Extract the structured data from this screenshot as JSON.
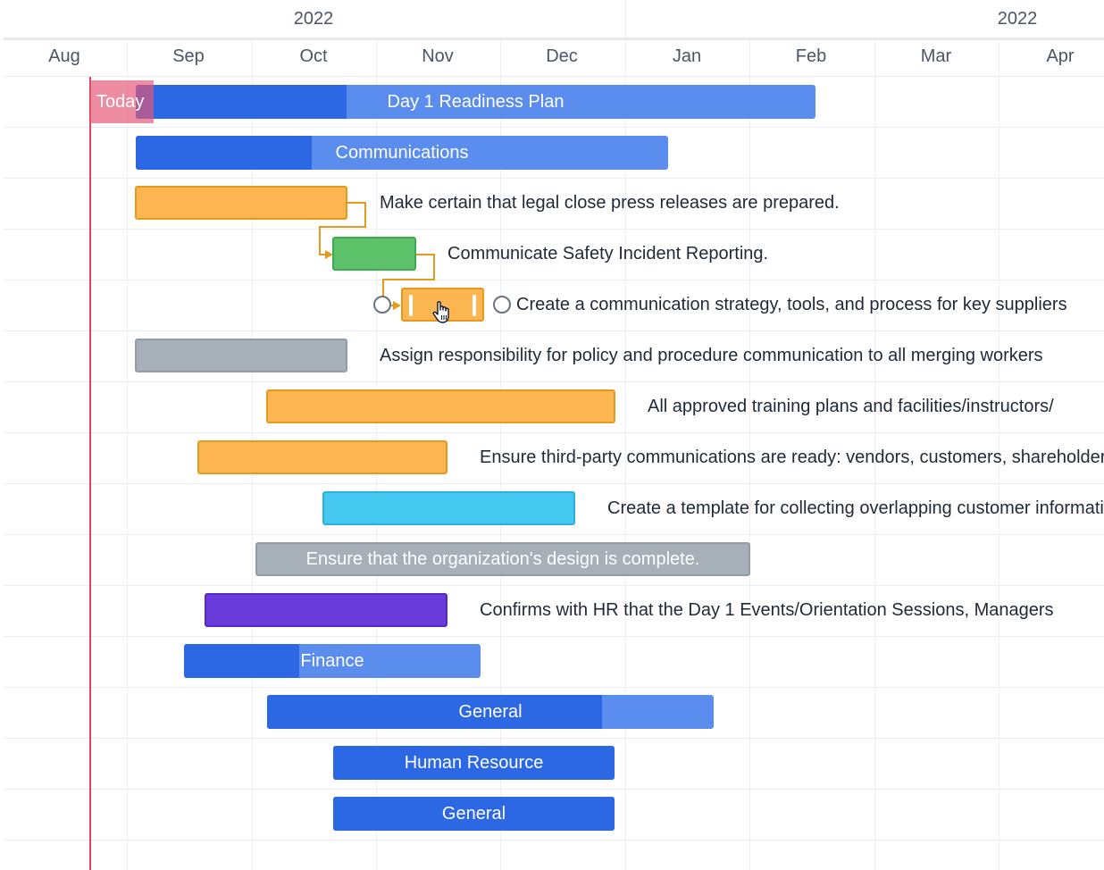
{
  "timeline": {
    "years": [
      "2022",
      "2022"
    ],
    "months": [
      "Aug",
      "Sep",
      "Oct",
      "Nov",
      "Dec",
      "Jan",
      "Feb",
      "Mar",
      "Apr"
    ],
    "today_label": "Today"
  },
  "tasks": [
    {
      "name": "Day 1 Readiness Plan",
      "label_position": "inside",
      "color": "#5b8def",
      "progress_color": "#2c68e3",
      "progress": 0.31
    },
    {
      "name": "Communications",
      "label_position": "inside",
      "color": "#5b8def",
      "progress_color": "#2c68e3",
      "progress": 0.33
    },
    {
      "name": "Make certain that legal close press releases are prepared.",
      "label_position": "outside",
      "color": "#fbb651",
      "border": "#e39a1f"
    },
    {
      "name": "Communicate Safety Incident Reporting.",
      "label_position": "outside",
      "color": "#5ec26a",
      "border": "#3fa94f"
    },
    {
      "name": "Create a communication strategy, tools, and process for key suppliers",
      "label_position": "outside",
      "color": "#fbb651",
      "border": "#e39a1f",
      "selected": true
    },
    {
      "name": "Assign responsibility for policy and procedure communication to all merging workers",
      "label_position": "outside",
      "color": "#a7b0b9",
      "border": "#939ca5"
    },
    {
      "name": "All approved training plans and facilities/instructors/",
      "label_position": "outside",
      "color": "#fbb651",
      "border": "#e39a1f"
    },
    {
      "name": "Ensure third-party communications are ready: vendors, customers, shareholders",
      "label_position": "outside",
      "color": "#fbb651",
      "border": "#e39a1f"
    },
    {
      "name": "Create a template for collecting overlapping customer information",
      "label_position": "outside",
      "color": "#45c8f0",
      "border": "#2bb1db"
    },
    {
      "name": "Ensure that the organization's design is complete.",
      "label_position": "inside",
      "color": "#a7b0b9",
      "border": "#939ca5"
    },
    {
      "name": "Confirms with HR that the Day 1 Events/Orientation Sessions, Managers",
      "label_position": "outside",
      "color": "#6a3bdb",
      "border": "#5628c4"
    },
    {
      "name": "Finance",
      "label_position": "inside",
      "color": "#5b8def",
      "progress_color": "#2c68e3",
      "progress": 0.39
    },
    {
      "name": "General",
      "label_position": "inside",
      "color": "#5b8def",
      "progress_color": "#2c68e3",
      "progress": 0.75
    },
    {
      "name": "Human Resource",
      "label_position": "inside",
      "color": "#2c68e3",
      "progress_color": "#2c68e3",
      "progress": 1.0
    },
    {
      "name": "General",
      "label_position": "inside",
      "color": "#2c68e3",
      "progress_color": "#2c68e3",
      "progress": 1.0
    }
  ],
  "colors": {
    "today": "#e0455f",
    "connector": "#e39a1f",
    "grid": "#eef0f3"
  }
}
